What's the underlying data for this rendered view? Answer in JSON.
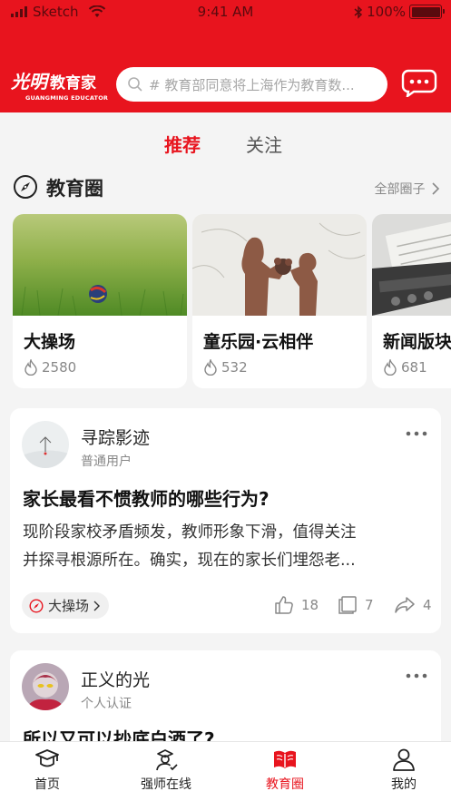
{
  "status_bar": {
    "carrier": "Sketch",
    "time": "9:41 AM",
    "battery": "100%"
  },
  "header": {
    "logo_script": "光明",
    "logo_cn": "教育家",
    "logo_en": "GUANGMING EDUCATOR",
    "search_placeholder": "# 教育部同意将上海作为教育数..."
  },
  "tabs": [
    {
      "label": "推荐",
      "active": true
    },
    {
      "label": "关注",
      "active": false
    }
  ],
  "circle_section": {
    "title": "教育圈",
    "all_label": "全部圈子"
  },
  "circle_cards": [
    {
      "title": "大操场",
      "heat": "2580",
      "image": "grass-field-with-ball"
    },
    {
      "title": "童乐园·云相伴",
      "heat": "532",
      "image": "mother-and-child-silhouette"
    },
    {
      "title": "新闻版块",
      "heat": "681",
      "image": "typewriter"
    }
  ],
  "posts": [
    {
      "author": "寻踪影迹",
      "role": "普通用户",
      "title": "家长最看不惯教师的哪些行为?",
      "body_lines": [
        "现阶段家校矛盾频发，教师形象下滑，值得关注",
        "并探寻根源所在。确实，现在的家长们埋怨老..."
      ],
      "tag": "大操场",
      "likes": "18",
      "comments": "7",
      "shares": "4"
    },
    {
      "author": "正义的光",
      "role": "个人认证",
      "title": "所以又可以抄底白酒了?"
    }
  ],
  "bottom_nav": [
    {
      "label": "首页",
      "icon": "graduation-cap-icon",
      "active": false
    },
    {
      "label": "强师在线",
      "icon": "teacher-icon",
      "active": false
    },
    {
      "label": "教育圈",
      "icon": "book-icon",
      "active": true
    },
    {
      "label": "我的",
      "icon": "user-icon",
      "active": false
    }
  ],
  "colors": {
    "brand_red": "#e8141e",
    "background": "#f4f4f4",
    "muted_text": "#888888"
  }
}
